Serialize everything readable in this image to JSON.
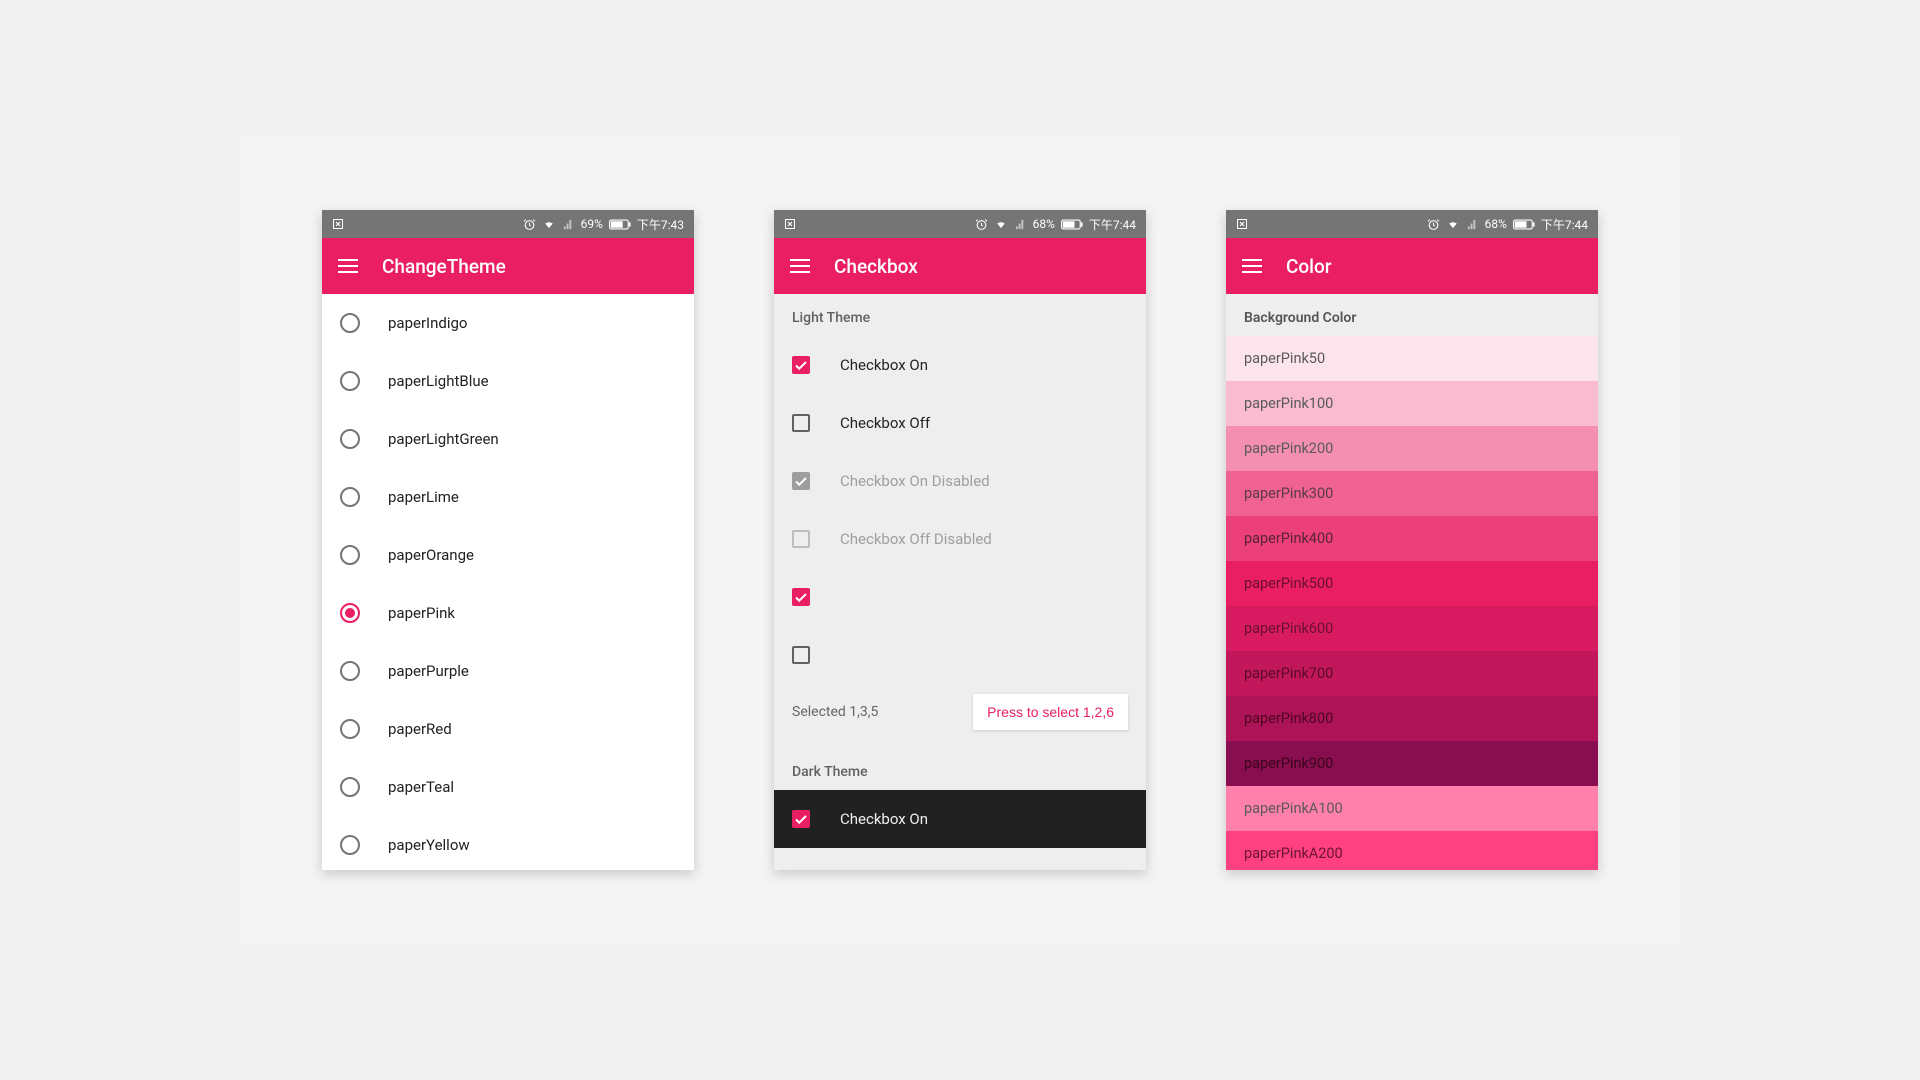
{
  "accent": "#e91e63",
  "status1": {
    "battery": "69%",
    "time": "下午7:43"
  },
  "status2": {
    "battery": "68%",
    "time": "下午7:44"
  },
  "status3": {
    "battery": "68%",
    "time": "下午7:44"
  },
  "screen1": {
    "title": "ChangeTheme",
    "items": [
      {
        "label": "paperIndigo",
        "selected": false
      },
      {
        "label": "paperLightBlue",
        "selected": false
      },
      {
        "label": "paperLightGreen",
        "selected": false
      },
      {
        "label": "paperLime",
        "selected": false
      },
      {
        "label": "paperOrange",
        "selected": false
      },
      {
        "label": "paperPink",
        "selected": true
      },
      {
        "label": "paperPurple",
        "selected": false
      },
      {
        "label": "paperRed",
        "selected": false
      },
      {
        "label": "paperTeal",
        "selected": false
      },
      {
        "label": "paperYellow",
        "selected": false
      }
    ]
  },
  "screen2": {
    "title": "Checkbox",
    "sectionLight": "Light Theme",
    "sectionDark": "Dark Theme",
    "rows": [
      {
        "label": "Checkbox On",
        "checked": true,
        "disabled": false
      },
      {
        "label": "Checkbox Off",
        "checked": false,
        "disabled": false
      },
      {
        "label": "Checkbox On Disabled",
        "checked": true,
        "disabled": true
      },
      {
        "label": "Checkbox Off Disabled",
        "checked": false,
        "disabled": true
      },
      {
        "label": "",
        "checked": true,
        "disabled": false
      },
      {
        "label": "",
        "checked": false,
        "disabled": false
      }
    ],
    "selectedText": "Selected 1,3,5",
    "pressButton": "Press to select 1,2,6",
    "darkRow": {
      "label": "Checkbox On",
      "checked": true
    }
  },
  "screen3": {
    "title": "Color",
    "header": "Background Color",
    "swatches": [
      {
        "label": "paperPink50",
        "bg": "#fce4ec",
        "fg": "#5a5a5a"
      },
      {
        "label": "paperPink100",
        "bg": "#f8bbd0",
        "fg": "#5a5a5a"
      },
      {
        "label": "paperPink200",
        "bg": "#f48fb1",
        "fg": "#5a5a5a"
      },
      {
        "label": "paperPink300",
        "bg": "#f06292",
        "fg": "#5a3a46"
      },
      {
        "label": "paperPink400",
        "bg": "#ec407a",
        "fg": "#5a2338"
      },
      {
        "label": "paperPink500",
        "bg": "#e91e63",
        "fg": "#6b0f32"
      },
      {
        "label": "paperPink600",
        "bg": "#d81b60",
        "fg": "#6b0f32"
      },
      {
        "label": "paperPink700",
        "bg": "#c2185b",
        "fg": "#5a0a28"
      },
      {
        "label": "paperPink800",
        "bg": "#ad1457",
        "fg": "#4d0622"
      },
      {
        "label": "paperPink900",
        "bg": "#880e4f",
        "fg": "#3a041c"
      },
      {
        "label": "paperPinkA100",
        "bg": "#ff80ab",
        "fg": "#5a5a5a"
      },
      {
        "label": "paperPinkA200",
        "bg": "#ff4081",
        "fg": "#6b1436"
      }
    ]
  }
}
